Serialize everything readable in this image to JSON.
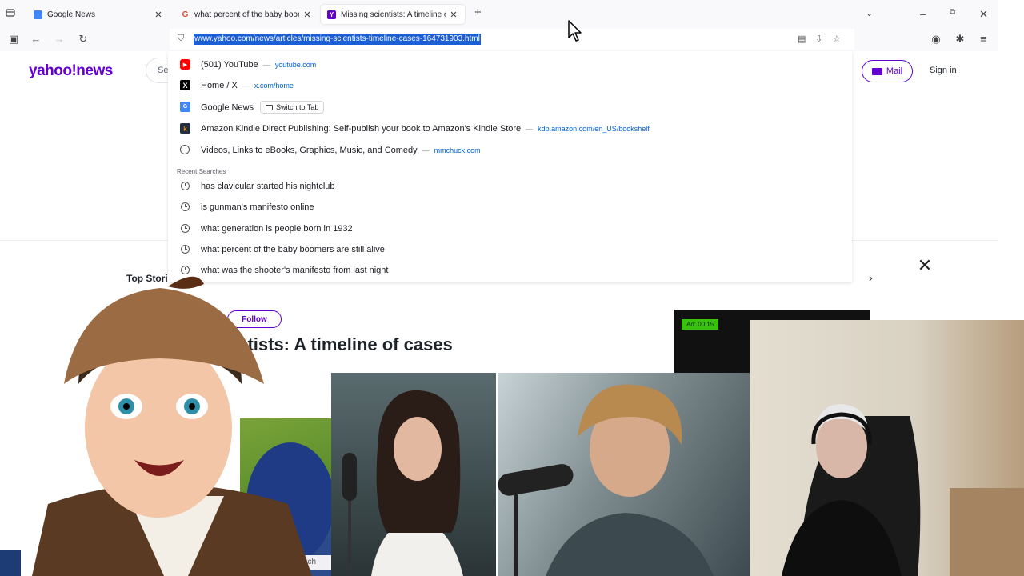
{
  "tabs": [
    {
      "title": "Google News",
      "favicon": "google-news-icon",
      "color": "#4285f4",
      "active": false
    },
    {
      "title": "what percent of the baby boom",
      "favicon": "google-icon",
      "color": "#ea4335",
      "active": false
    },
    {
      "title": "Missing scientists: A timeline of",
      "favicon": "yahoo-icon",
      "color": "#6001d2",
      "active": true
    }
  ],
  "urlbar": {
    "url": "www.yahoo.com/news/articles/missing-scientists-timeline-cases-164731903.html"
  },
  "dropdown": {
    "suggestions": [
      {
        "title": "(501) YouTube",
        "host": "youtube.com",
        "icon": "youtube-icon",
        "icon_color": "#ff0000"
      },
      {
        "title": "Home / X",
        "host": "x.com/home",
        "icon": "x-icon",
        "icon_color": "#000000"
      },
      {
        "title": "Google News",
        "chip": "Switch to Tab",
        "icon": "google-news-icon",
        "icon_color": "#4285f4"
      },
      {
        "title": "Amazon Kindle Direct Publishing: Self-publish your book to Amazon's Kindle Store",
        "host": "kdp.amazon.com/en_US/bookshelf",
        "icon": "kindle-icon",
        "icon_color": "#232f3e"
      },
      {
        "title": "Videos, Links to eBooks, Graphics, Music, and Comedy",
        "host": "mmchuck.com",
        "icon": "globe-icon",
        "icon_color": "#555555"
      }
    ],
    "section_label": "Recent Searches",
    "recent": [
      "has clavicular started his nightclub",
      "is gunman's manifesto online",
      "what generation is people born in 1932",
      "what percent of the baby boomers are still alive",
      "what was the shooter's manifesto from last night"
    ]
  },
  "page": {
    "logo": "yahoo!news",
    "search_stub": "Se",
    "mail_label": "Mail",
    "signin_label": "Sign in",
    "top_stories_label": "Top Stori",
    "follow_label": "Follow",
    "headline_fragment": "ntists: A timeline of cases",
    "ad_label": "Ad: 00:15",
    "search_bottom": "earch"
  },
  "colors": {
    "accent": "#6001d2",
    "url_selection": "#1a5fd6",
    "link": "#0061e0"
  }
}
